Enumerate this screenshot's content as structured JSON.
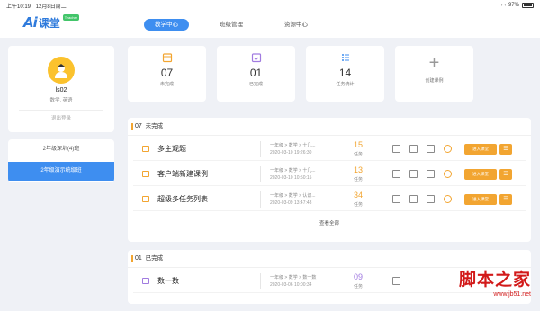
{
  "status_bar": {
    "time": "上午10:19",
    "date": "12月8日周二",
    "wifi": "wifi-icon",
    "battery": "97%"
  },
  "app": {
    "logo_ai": "Ai",
    "logo_word": "课堂",
    "logo_badge": "Teacher"
  },
  "nav": {
    "tabs": [
      {
        "label": "教学中心",
        "active": true
      },
      {
        "label": "班级管理",
        "active": false
      },
      {
        "label": "资源中心",
        "active": false
      }
    ]
  },
  "profile": {
    "name": "ls02",
    "subjects": "数学, 英语",
    "logout": "退出登录"
  },
  "classes": [
    {
      "label": "2年级深圳(4)班",
      "active": false
    },
    {
      "label": "2年级演示统级班",
      "active": true
    }
  ],
  "stats": [
    {
      "icon": "calendar-icon",
      "num": "07",
      "label": "未完成"
    },
    {
      "icon": "checked-calendar-icon",
      "num": "01",
      "label": "已完成"
    },
    {
      "icon": "list-icon",
      "num": "14",
      "label": "任务统计"
    },
    {
      "icon": "plus-icon",
      "num": "+",
      "label": "创建课例"
    }
  ],
  "pending": {
    "count": "07",
    "title": "未完成",
    "rows": [
      {
        "title": "多主观题",
        "path": "一年级 > 数学 > 十几...",
        "time": "2020-03-10 19:26:30",
        "tasks": "15",
        "tasks_label": "任务",
        "enter": "进入课堂",
        "menu": "☰"
      },
      {
        "title": "客户端新建课例",
        "path": "一年级 > 数学 > 十几...",
        "time": "2020-03-10 10:50:15",
        "tasks": "13",
        "tasks_label": "任务",
        "enter": "进入课堂",
        "menu": "☰"
      },
      {
        "title": "超级多任务列表",
        "path": "一年级 > 数学 > 认识...",
        "time": "2020-03-09 13:47:48",
        "tasks": "34",
        "tasks_label": "任务",
        "enter": "进入课堂",
        "menu": "☰"
      }
    ],
    "view_all": "查看全部"
  },
  "done": {
    "count": "01",
    "title": "已完成",
    "rows": [
      {
        "title": "数一数",
        "path": "一年级 > 数学 > 数一数",
        "time": "2020-03-06 10:00:34",
        "tasks": "09",
        "tasks_label": "任务"
      }
    ]
  },
  "watermark": {
    "line1": "脚本之家",
    "line2": "www.jb51.net"
  },
  "colors": {
    "primary": "#3e8ef0",
    "accent": "#f2a531",
    "purple": "#a17be0"
  }
}
